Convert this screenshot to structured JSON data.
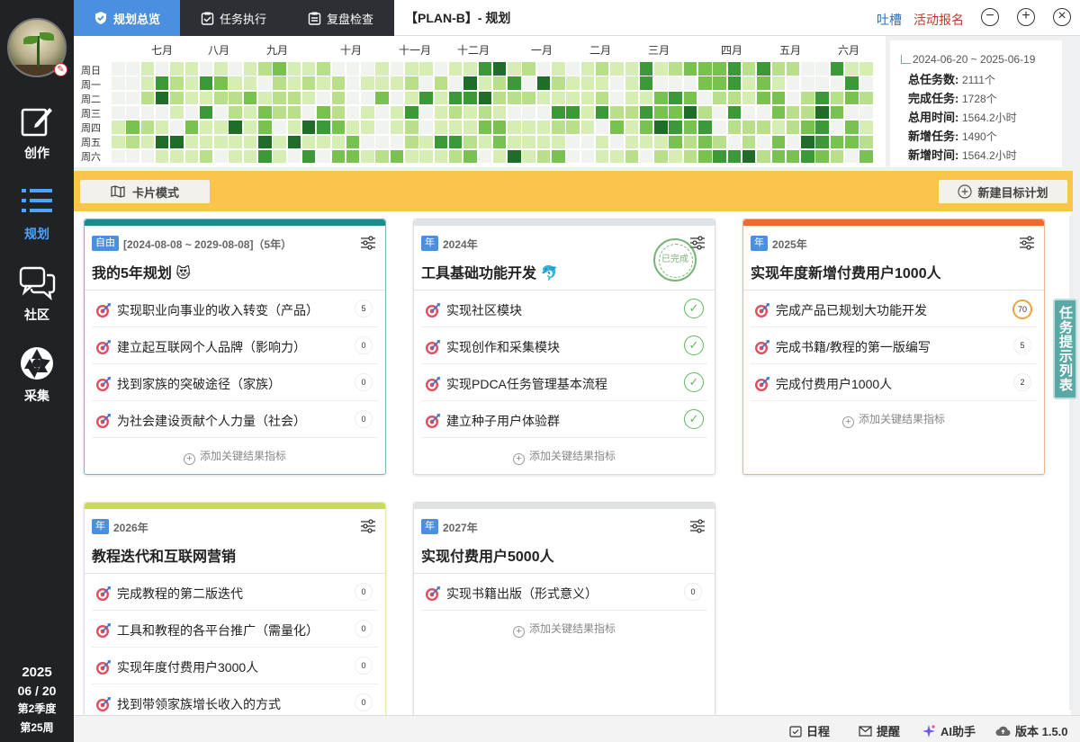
{
  "sidebar": {
    "nav": [
      {
        "label": "创作",
        "icon": "edit-icon"
      },
      {
        "label": "规划",
        "icon": "list-icon",
        "active": true
      },
      {
        "label": "社区",
        "icon": "chat-icon"
      },
      {
        "label": "采集",
        "icon": "aperture-icon"
      }
    ],
    "date": {
      "year": "2025",
      "day": "06 / 20",
      "quarter": "第2季度",
      "week": "第25周"
    }
  },
  "topbar": {
    "tabs": [
      "规划总览",
      "任务执行",
      "复盘检查"
    ],
    "title": "【PLAN-B】- 规划",
    "feedback": "吐槽",
    "event": "活动报名"
  },
  "heatmap": {
    "months": [
      "七月",
      "八月",
      "九月",
      "十月",
      "十一月",
      "十二月",
      "一月",
      "二月",
      "三月",
      "四月",
      "五月",
      "六月"
    ],
    "weekdays": [
      "周日",
      "周一",
      "周二",
      "周三",
      "周四",
      "周五",
      "周六"
    ],
    "palette": [
      "#f1f3ef",
      "#d6edb4",
      "#b8e08a",
      "#78c350",
      "#3b9a37",
      "#1f6d28"
    ]
  },
  "stats": {
    "range": "2024-06-20 ~ 2025-06-19",
    "rows": [
      {
        "label": "总任务数:",
        "value": "2111个"
      },
      {
        "label": "完成任务:",
        "value": "1728个"
      },
      {
        "label": "总用时间:",
        "value": "1564.2小时"
      },
      {
        "label": "新增任务:",
        "value": "1490个"
      },
      {
        "label": "新增时间:",
        "value": "1564.2小时"
      }
    ]
  },
  "toolbar": {
    "card_mode": "卡片模式",
    "new_plan": "新建目标计划"
  },
  "add_kr_label": "添加关键结果指标",
  "cards": [
    {
      "tag": "自由",
      "meta": "[2024-08-08 ~ 2029-08-08]（5年）",
      "title": "我的5年规划",
      "emoji": "😻",
      "stripe": "#1a8a8a",
      "items": [
        {
          "text": "实现职业向事业的收入转变（产品）",
          "count": "5"
        },
        {
          "text": "建立起互联网个人品牌（影响力）",
          "count": "0"
        },
        {
          "text": "找到家族的突破途径（家族）",
          "count": "0"
        },
        {
          "text": "为社会建设贡献个人力量（社会）",
          "count": "0"
        }
      ]
    },
    {
      "tag": "年",
      "meta": "2024年",
      "title": "工具基础功能开发",
      "emoji": "🐬",
      "stripe": "#dfe3e6",
      "stamp": "已完成",
      "items": [
        {
          "text": "实现社区模块",
          "done": true
        },
        {
          "text": "实现创作和采集模块",
          "done": true
        },
        {
          "text": "实现PDCA任务管理基本流程",
          "done": true
        },
        {
          "text": "建立种子用户体验群",
          "done": true
        }
      ]
    },
    {
      "tag": "年",
      "meta": "2025年",
      "title": "实现年度新增付费用户1000人",
      "stripe": "#ec6a2c",
      "items": [
        {
          "text": "完成产品已规划大功能开发",
          "count": "70"
        },
        {
          "text": "完成书籍/教程的第一版编写",
          "count": "5"
        },
        {
          "text": "完成付费用户1000人",
          "count": "2"
        }
      ]
    },
    {
      "tag": "年",
      "meta": "2026年",
      "title": "教程迭代和互联网营销",
      "stripe": "#c9dc5a",
      "items": [
        {
          "text": "完成教程的第二版迭代",
          "count": "0"
        },
        {
          "text": "工具和教程的各平台推广（需量化）",
          "count": "0"
        },
        {
          "text": "实现年度付费用户3000人",
          "count": "0"
        },
        {
          "text": "找到带领家族增长收入的方式",
          "count": "0"
        }
      ]
    },
    {
      "tag": "年",
      "meta": "2027年",
      "title": "实现付费用户5000人",
      "stripe": "#dfe3e6",
      "items": [
        {
          "text": "实现书籍出版（形式意义）",
          "count": "0"
        }
      ]
    }
  ],
  "drawer": "任务提示列表",
  "statusbar": {
    "schedule": "日程",
    "reminder": "提醒",
    "ai": "AI助手",
    "version": "版本 1.5.0"
  }
}
